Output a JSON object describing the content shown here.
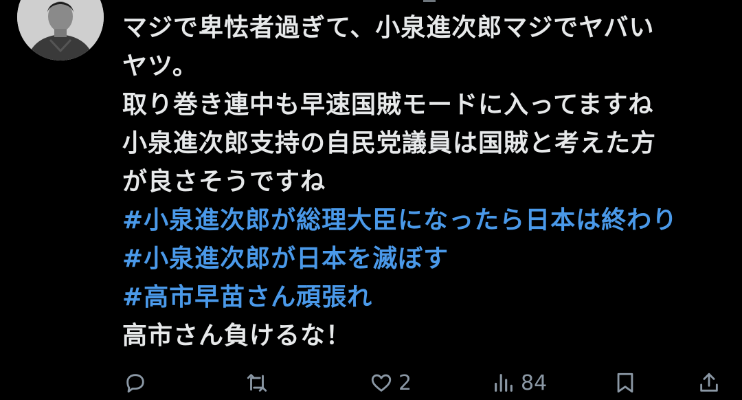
{
  "tweet": {
    "lines": [
      "マジで卑怯者過ぎて、小泉進次郎マジでヤバい",
      "ヤツ。",
      "取り巻き連中も早速国賊モードに入ってますね",
      "小泉進次郎支持の自民党議員は国賊と考えた方",
      "が良さそうですね"
    ],
    "hashtags": [
      "#小泉進次郎が総理大臣になったら日本は終わり",
      "#小泉進次郎が日本を滅ぼす",
      "#高市早苗さん頑張れ"
    ],
    "closing": "高市さん負けるな！"
  },
  "actions": {
    "like_count": "2",
    "views_count": "84"
  },
  "colors": {
    "background": "#000000",
    "text": "#e7e9ea",
    "hashtag": "#4a99e9",
    "icon": "#8b98a5"
  },
  "icons": {
    "reply": "reply-icon",
    "retweet": "retweet-icon",
    "like": "heart-icon",
    "views": "views-chart-icon",
    "bookmark": "bookmark-icon",
    "share": "share-icon"
  }
}
